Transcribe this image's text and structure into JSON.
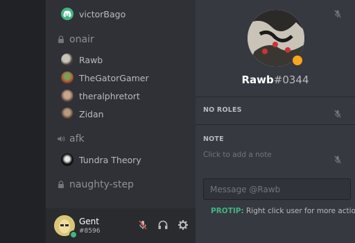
{
  "voice_users_top": [
    {
      "name": "victorBago",
      "muted": true,
      "avatar_color": "#43b581"
    }
  ],
  "channels": {
    "onair": {
      "name": "onair",
      "icon": "lock-icon"
    },
    "afk": {
      "name": "afk",
      "icon": "speaker-icon"
    },
    "naughty_step": {
      "name": "naughty-step",
      "icon": "lock-icon"
    }
  },
  "onair_users": [
    {
      "name": "Rawb",
      "muted": false
    },
    {
      "name": "TheGatorGamer",
      "muted": false
    },
    {
      "name": "theralphretort",
      "muted": false
    },
    {
      "name": "Zidan",
      "muted": true
    }
  ],
  "afk_users": [
    {
      "name": "Tundra Theory",
      "muted": true
    }
  ],
  "user_panel": {
    "name": "Gent",
    "discriminator": "#8596",
    "status_color": "#43b581"
  },
  "profile": {
    "username": "Rawb",
    "discriminator": "#0344",
    "status_color": "#faa61a",
    "roles_title": "NO ROLES",
    "note_title": "NOTE",
    "note_placeholder": "Click to add a note",
    "message_placeholder": "Message @Rawb",
    "protip_label": "PROTIP:",
    "protip_text": "Right click user for more actions"
  },
  "colors": {
    "sidebar": "#2f3136",
    "main": "#36393f",
    "rail": "#202225",
    "accent_green": "#43b581",
    "idle_orange": "#faa61a"
  }
}
